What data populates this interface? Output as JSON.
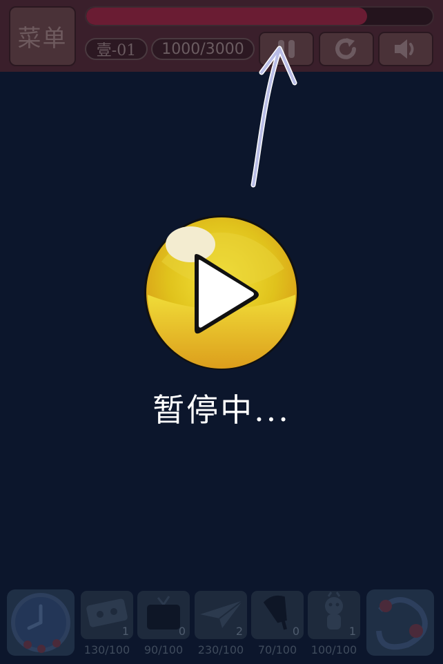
{
  "hud": {
    "menu_label": "菜单",
    "level_label": "壹-01",
    "score_text": "1000/3000",
    "score_progress": 0.81,
    "buttons": {
      "pause_icon": "pause-icon",
      "restart_icon": "restart-icon",
      "sound_icon": "sound-icon"
    }
  },
  "overlay": {
    "status_text": "暂停中...",
    "play_icon": "play-icon",
    "arrow_icon": "arrow-up-icon"
  },
  "items": [
    {
      "name": "cassette",
      "icon": "cassette-icon",
      "count": "1",
      "label": "130/100"
    },
    {
      "name": "tv",
      "icon": "tv-icon",
      "count": "0",
      "label": "90/100"
    },
    {
      "name": "paper-plane",
      "icon": "paper-plane-icon",
      "count": "2",
      "label": "230/100"
    },
    {
      "name": "popsicle",
      "icon": "popsicle-icon",
      "count": "0",
      "label": "70/100"
    },
    {
      "name": "monkey-toy",
      "icon": "monkey-toy-icon",
      "count": "1",
      "label": "100/100"
    }
  ],
  "colors": {
    "background": "#0c162c",
    "play_gold": "#e6c62a",
    "arrow": "#b9bde6"
  }
}
